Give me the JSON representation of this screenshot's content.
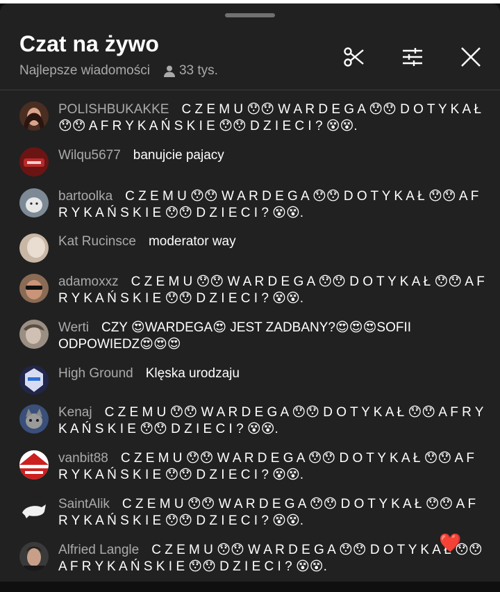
{
  "header": {
    "title": "Czat na żywo",
    "mode": "Najlepsze wiadomości",
    "viewers": "33 tys.",
    "icons": [
      "scissors-icon",
      "sliders-icon",
      "close-icon"
    ]
  },
  "colors": {
    "sheet_bg": "#212121",
    "author_text": "#aaaaaa",
    "message_text": "#ffffff",
    "background": "#0f0f0f"
  },
  "messages": [
    {
      "author": "POLISHBUKAKKE",
      "text": "C Z E M U 😯😯 W A R D E G A 😯😯 D O T Y K A Ł 😯😯 A F R Y K A Ń S K I E 😯😯 D Z I E C I ? 😵😵."
    },
    {
      "author": "Wilqu5677",
      "text": "banujcie pajacy"
    },
    {
      "author": "bartoolka",
      "text": "C Z E M U 😯😯 W A R D E G A 😯😯 D O T Y K A Ł 😯😯 A F R Y K A Ń S K I E 😯😯 D Z I E C I ? 😵😵."
    },
    {
      "author": "Kat Rucinsce",
      "text": "moderator way"
    },
    {
      "author": "adamoxxz",
      "text": "C Z E M U 😯😯 W A R D E G A 😯😯 D O T Y K A Ł 😯😯 A F R Y K A Ń S K I E 😯😯 D Z I E C I ? 😵😵."
    },
    {
      "author": "Werti",
      "text": "CZY 😍WARDEGA😍 JEST ZADBANY?😍😍😍SOFII ODPOWIEDZ😍😍😍"
    },
    {
      "author": "High Ground",
      "text": "Klęska urodzaju"
    },
    {
      "author": "Kenaj",
      "text": "C Z E M U 😯😯 W A R D E G A 😯😯 D O T Y K A Ł 😯😯 A F R Y K A Ń S K I E 😯😯 D Z I E C I ? 😵😵."
    },
    {
      "author": "vanbit88",
      "text": "C Z E M U 😯😯 W A R D E G A 😯😯 D O T Y K A Ł 😯😯 A F R Y K A Ń S K I E 😯😯 D Z I E C I ? 😵😵."
    },
    {
      "author": "SaintAlik",
      "text": "C Z E M U 😯😯 W A R D E G A 😯😯 D O T Y K A Ł 😯😯 A F R Y K A Ń S K I E 😯😯 D Z I E C I ? 😵😵."
    },
    {
      "author": "Alfried Langle",
      "text": "C Z E M U 😯😯 W A R D E G A 😯😯 D O T Y K A Ł 😯😯 A F R Y K A Ń S K I E 😯😯 D Z I E C I ? 😵😵."
    }
  ],
  "reaction": "❤️"
}
